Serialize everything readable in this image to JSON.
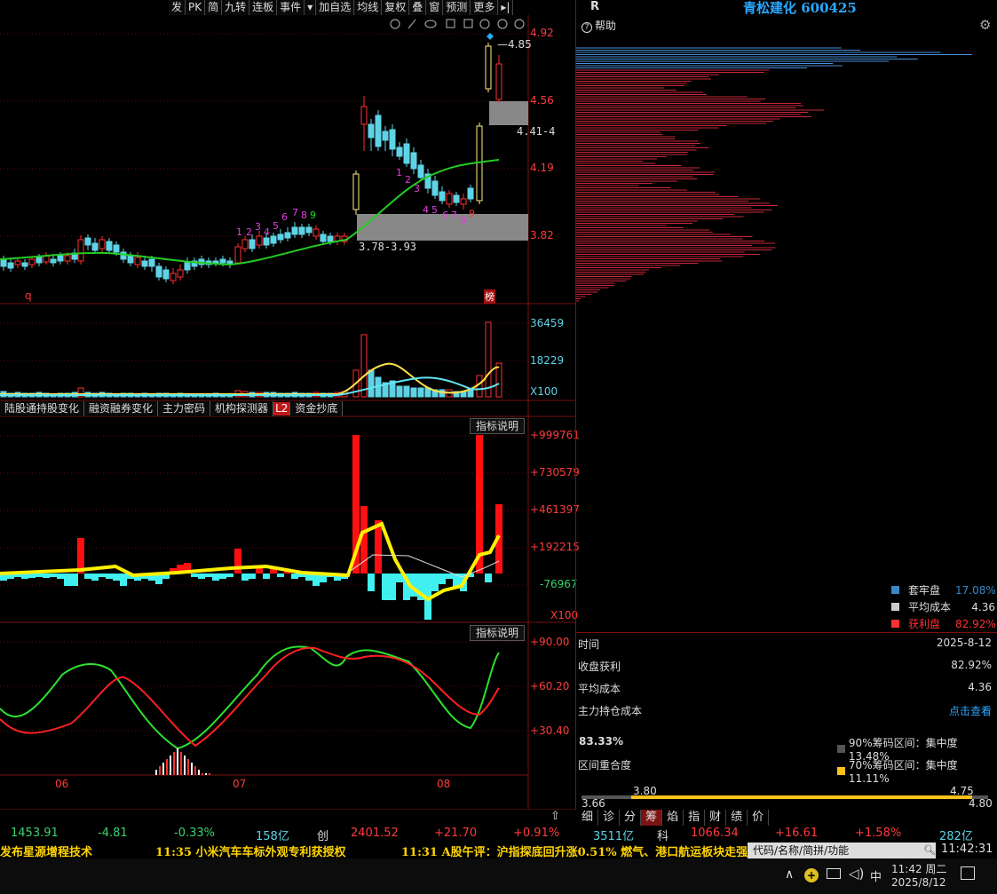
{
  "toolbar": {
    "items": [
      "发",
      "PK",
      "简",
      "九转",
      "连板",
      "事件",
      "▾",
      "加自选",
      "均线",
      "复权",
      "叠",
      "窗",
      "预测",
      "更多",
      "▸|"
    ]
  },
  "main_chart": {
    "price_ticks": [
      "4.92",
      "4.56",
      "4.19",
      "3.82"
    ],
    "high_label": "4.85",
    "gap_label_upper": "4.41-4",
    "gap_label_lower": "3.78-3.93",
    "count_up": [
      "1",
      "2",
      "3",
      "4",
      "5",
      "6",
      "7",
      "8",
      "9"
    ],
    "count_down": [
      "1",
      "2",
      "3",
      "4",
      "5",
      "6",
      "7",
      "8",
      "9"
    ],
    "marker_q": "q",
    "marker_bang": "榜"
  },
  "volume_panel": {
    "ticks": [
      "36459",
      "18229",
      "X100"
    ]
  },
  "tabs": [
    "陆股通持股变化",
    "融资融券变化",
    "主力密码",
    "机构探测器",
    "L2",
    "资金抄底"
  ],
  "fund_panel": {
    "explain": "指标说明",
    "ticks": [
      "+999761",
      "+730579",
      "+461397",
      "+192215",
      "-76967",
      "X100"
    ]
  },
  "kdj_panel": {
    "explain": "指标说明",
    "ticks": [
      "+90.00",
      "+60.20",
      "+30.40"
    ],
    "months": [
      "06",
      "07",
      "08"
    ]
  },
  "right_panel": {
    "r_label": "R",
    "title": "青松建化 600425",
    "help": "帮助",
    "legend": [
      {
        "label": "套牢盘",
        "value": "17.08%",
        "color": "#3a86c8"
      },
      {
        "label": "平均成本",
        "value": "4.36",
        "color": "#cccccc"
      },
      {
        "label": "获利盘",
        "value": "82.92%",
        "color": "#ff3030"
      }
    ],
    "rows": [
      {
        "k": "时间",
        "v": "2025-8-12"
      },
      {
        "k": "收盘获利",
        "v": "82.92%"
      },
      {
        "k": "平均成本",
        "v": "4.36"
      },
      {
        "k": "主力持仓成本",
        "v": "点击查看"
      }
    ],
    "concentration": "83.33%",
    "overlap_label": "区间重合度",
    "range90": "90%筹码区间：集中度13.48%",
    "range70": "70%筹码区间：集中度11.11%",
    "scale": {
      "a": "3.80",
      "b": "4.75",
      "left": "3.66",
      "right": "4.80"
    }
  },
  "bottom_tabs": [
    "细",
    "诊",
    "分",
    "筹",
    "焰",
    "指",
    "财",
    "绩",
    "价"
  ],
  "index_bar": {
    "sh_val": "1453.91",
    "sh_chg": "-4.81",
    "sh_pct": "-0.33%",
    "sh_amt": "158亿",
    "cy_name": "创",
    "cy_val": "2401.52",
    "cy_chg": "+21.70",
    "cy_pct": "+0.91%",
    "cy_amt": "3511亿",
    "kc_name": "科",
    "kc_val": "1066.34",
    "kc_chg": "+16.61",
    "kc_pct": "+1.58%",
    "kc_amt": "282亿"
  },
  "news": {
    "n1": "发布星源增程技术",
    "n2": "11:35 小米汽车车标外观专利获授权",
    "n3": "11:31 A股午评：沪指探底回升涨0.51% 燃气、港口航运板块走强"
  },
  "search_placeholder": "代码/名称/简拼/功能",
  "clock": "11:42:31",
  "taskbar": {
    "time": "11:42 周二",
    "date": "2025/8/12",
    "ime": "中"
  }
}
